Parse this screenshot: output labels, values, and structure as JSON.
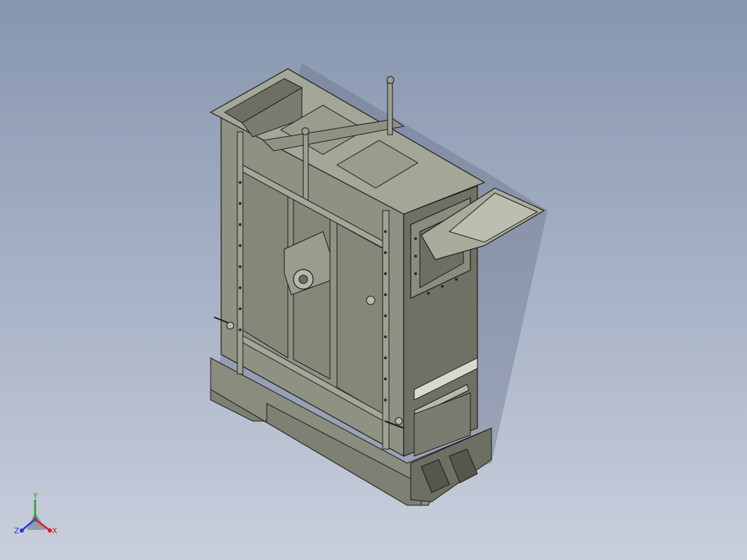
{
  "viewport": {
    "background_top": "#8796ae",
    "background_bottom": "#c9cfdc"
  },
  "model": {
    "body_color": "#8a8c7e",
    "body_dark": "#6d6f63",
    "body_light": "#a4a697",
    "edge_color": "#1a1a1a"
  },
  "triad": {
    "x_label": "X",
    "y_label": "Y",
    "z_label": "Z",
    "x_color": "#d42020",
    "y_color": "#22a022",
    "z_color": "#2a3ad0"
  }
}
